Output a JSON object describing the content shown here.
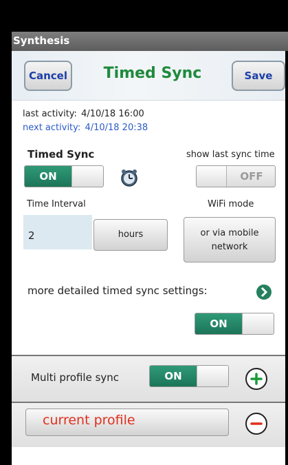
{
  "app": {
    "title": "Synthesis"
  },
  "header": {
    "cancel_label": "Cancel",
    "title": "Timed Sync",
    "save_label": "Save"
  },
  "activity": {
    "last_label": "last activity:",
    "last_value": "4/10/18  16:00",
    "next_label": "next activity:",
    "next_value": "4/10/18  20:38"
  },
  "timed_sync": {
    "label": "Timed Sync",
    "toggle_state": "ON",
    "icon": "clock-icon"
  },
  "show_last_sync": {
    "label": "show last sync time",
    "toggle_state": "OFF"
  },
  "interval": {
    "label": "Time Interval",
    "value": "2",
    "unit_label": "hours"
  },
  "wifi": {
    "label": "WiFi mode",
    "button_label_line1": "or via mobile",
    "button_label_line2": "network"
  },
  "detailed": {
    "label": "more detailed timed sync settings:",
    "icon": "chevron-right-icon",
    "toggle_state": "ON"
  },
  "multi_profile": {
    "label": "Multi profile sync",
    "toggle_state": "ON",
    "icon": "plus-icon"
  },
  "current_profile": {
    "label": "current profile",
    "icon": "minus-icon"
  },
  "colors": {
    "accent_green": "#1f8a3c",
    "toggle_on": "#22805f",
    "link_blue": "#1d3fa8",
    "profile_red": "#e0301e"
  }
}
